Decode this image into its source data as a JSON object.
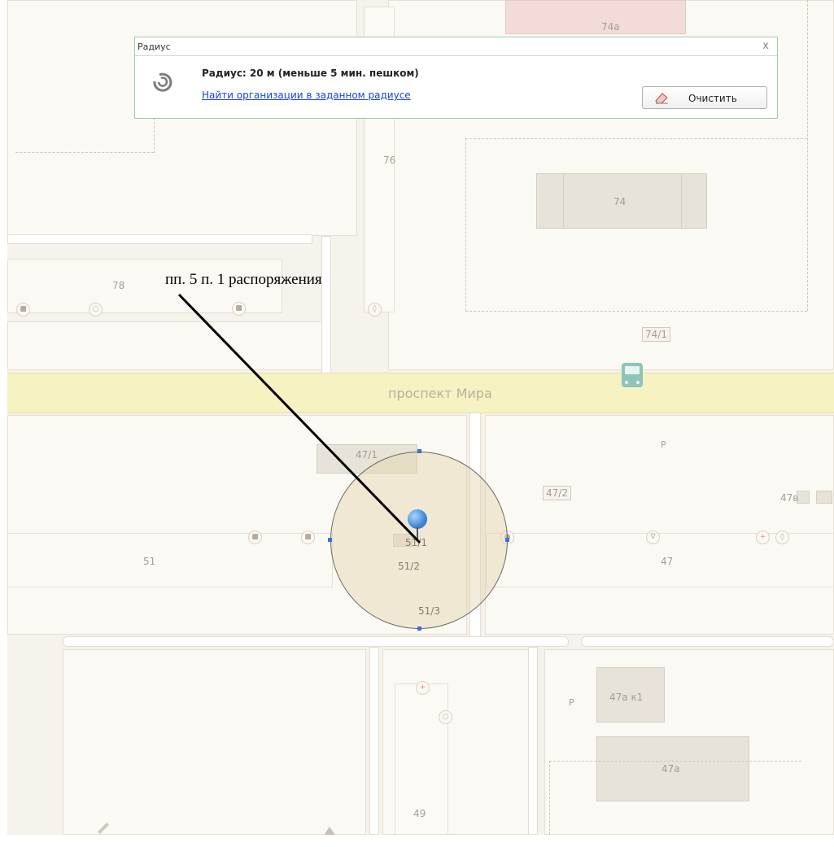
{
  "panel": {
    "title": "Радиус",
    "close": "x",
    "radius_text": "Радиус: 20 м (меньше 5 мин. пешком)",
    "find_link": "Найти организации в заданном радиусе",
    "clear_label": "Очистить"
  },
  "map": {
    "street": "проспект Мира",
    "labels": {
      "b74a": "74а",
      "b76": "76",
      "b74": "74",
      "b74_1": "74/1",
      "b78": "78",
      "b47_1": "47/1",
      "b47_2": "47/2",
      "b47v": "47в",
      "b51": "51",
      "b51_1": "51/1",
      "b51_2": "51/2",
      "b51_3": "51/3",
      "b47": "47",
      "b47a_k1": "47а к1",
      "b47a": "47а",
      "b49": "49",
      "parking1": "Р",
      "parking2": "Р"
    },
    "colors": {
      "street": "#f7f2c1",
      "radius_fill": "#e2d2ae",
      "marker": "#3e86d6",
      "link": "#1a44d8"
    }
  },
  "annotation": {
    "text": "пп. 5 п. 1 распоряжения"
  }
}
